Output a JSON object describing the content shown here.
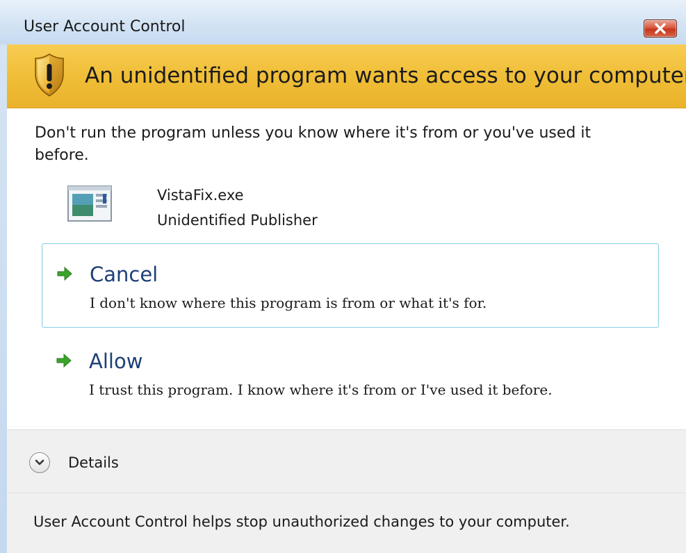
{
  "window": {
    "title": "User Account Control",
    "close_icon": "close-icon"
  },
  "banner": {
    "icon": "warning-shield-icon",
    "message": "An unidentified program wants access to your computer"
  },
  "content": {
    "warning": "Don't run the program unless you know where it's from or you've used it before.",
    "program": {
      "icon": "program-window-icon",
      "name": "VistaFix.exe",
      "publisher": "Unidentified Publisher"
    },
    "choices": [
      {
        "icon": "green-arrow-icon",
        "title": "Cancel",
        "description": "I don't know where this program is from or what it's for."
      },
      {
        "icon": "green-arrow-icon",
        "title": "Allow",
        "description": "I trust this program. I know where it's from or I've used it before."
      }
    ]
  },
  "details": {
    "icon": "chevron-down-icon",
    "label": "Details"
  },
  "footer": {
    "text": "User Account Control helps stop unauthorized changes to your computer."
  },
  "colors": {
    "banner": "#f0be38",
    "choice_title": "#1d3f77",
    "selected_border": "#8fd3e8",
    "arrow": "#3aa52a"
  }
}
